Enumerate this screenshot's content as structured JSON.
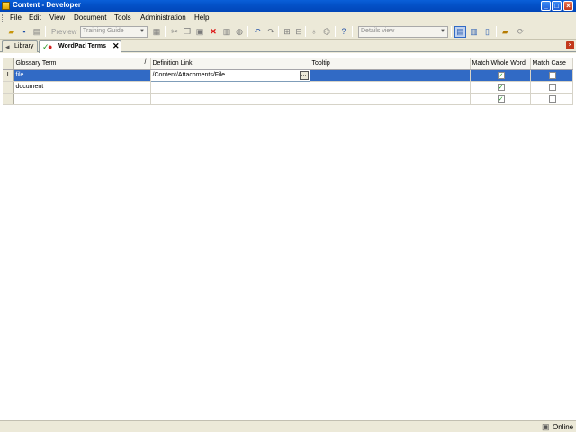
{
  "window": {
    "title": "Content - Developer",
    "icon": "app-icon",
    "controls": [
      "minimize-icon",
      "maximize-icon",
      "close-icon"
    ]
  },
  "menu": {
    "items": [
      "File",
      "Edit",
      "View",
      "Document",
      "Tools",
      "Administration",
      "Help"
    ]
  },
  "toolbar": {
    "preview_label": "Preview",
    "guide_select": "Training Guide",
    "view_select": "Details view",
    "icons": [
      "open-folder-icon",
      "save-icon",
      "print-icon",
      "cut-icon",
      "copy-icon",
      "paste-icon",
      "delete-icon",
      "properties-icon",
      "link-icon",
      "undo-icon",
      "redo-icon",
      "indent-icon",
      "outdent-icon",
      "find-icon",
      "filter-icon",
      "help-icon",
      "details-view-icon",
      "list-view-icon",
      "columns-view-icon",
      "publish-icon",
      "refresh-icon"
    ]
  },
  "tabs": [
    {
      "label": "Library",
      "icon": "library-icon",
      "active": false
    },
    {
      "label": "WordPad Terms",
      "icon": "check-document-icon",
      "active": true
    }
  ],
  "grid": {
    "columns": [
      "Glossary Term",
      "Definition Link",
      "Tooltip",
      "Match Whole Word",
      "Match Case"
    ],
    "sort_indicator": "/",
    "row_header_marker": "I",
    "rows": [
      {
        "term": "file",
        "link": "/Content/Attachments/File",
        "tooltip": "",
        "match_whole_word": true,
        "match_case": false,
        "selected": true
      },
      {
        "term": "document",
        "link": "",
        "tooltip": "",
        "match_whole_word": true,
        "match_case": false,
        "selected": false
      },
      {
        "term": "",
        "link": "",
        "tooltip": "",
        "match_whole_word": true,
        "match_case": false,
        "selected": false
      }
    ]
  },
  "status": {
    "text": "Online",
    "icon": "network-icon"
  }
}
